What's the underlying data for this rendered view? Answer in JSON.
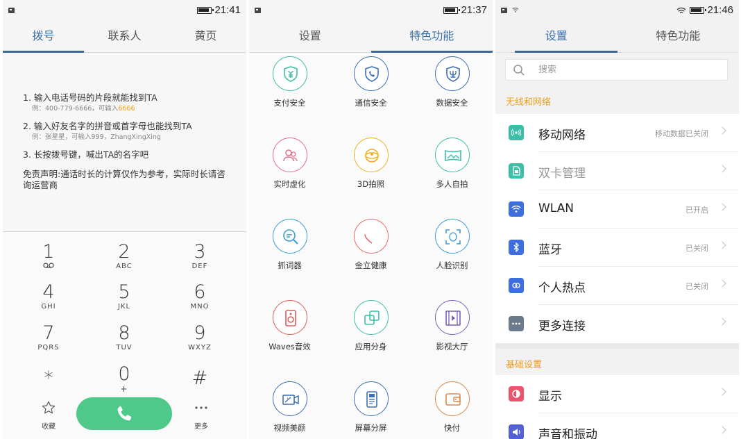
{
  "dialer": {
    "status": {
      "time": "21:41"
    },
    "tabs": [
      "拨号",
      "联系人",
      "黄页"
    ],
    "hints": [
      {
        "title": "1. 输入电话号码的片段就能找到TA",
        "example_prefix": "例：400-779-6666，可输入",
        "example_highlight": "6666"
      },
      {
        "title": "2. 输入好友名字的拼音或首字母也能找到TA",
        "example_prefix": "例：张星星，可输入999，ZhangXingXing",
        "example_highlight": ""
      },
      {
        "title": "3. 长按拨号键，喊出TA的名字吧",
        "example_prefix": "",
        "example_highlight": ""
      }
    ],
    "disclaimer": "免责声明:通话时长的计算仅作为参考，实际时长请咨询运营商",
    "keys": [
      {
        "digit": "1",
        "letters": ""
      },
      {
        "digit": "2",
        "letters": "ABC"
      },
      {
        "digit": "3",
        "letters": "DEF"
      },
      {
        "digit": "4",
        "letters": "GHI"
      },
      {
        "digit": "5",
        "letters": "JKL"
      },
      {
        "digit": "6",
        "letters": "MNO"
      },
      {
        "digit": "7",
        "letters": "PQRS"
      },
      {
        "digit": "8",
        "letters": "TUV"
      },
      {
        "digit": "9",
        "letters": "WXYZ"
      },
      {
        "digit": "*",
        "letters": ""
      },
      {
        "digit": "0",
        "letters": "+"
      },
      {
        "digit": "#",
        "letters": ""
      }
    ],
    "favorites_label": "收藏",
    "more_label": "更多",
    "call_color": "#4ec98a"
  },
  "features": {
    "status": {
      "time": "21:37"
    },
    "tabs": [
      "设置",
      "特色功能"
    ],
    "items": [
      {
        "label": "支付安全",
        "icon": "shield-yen-icon",
        "color": "#3bbfa8"
      },
      {
        "label": "通信安全",
        "icon": "shield-phone-icon",
        "color": "#3d6fb4"
      },
      {
        "label": "数据安全",
        "icon": "shield-data-icon",
        "color": "#3d6fb4"
      },
      {
        "label": "实时虚化",
        "icon": "people-blur-icon",
        "color": "#e46b86"
      },
      {
        "label": "3D拍照",
        "icon": "3d-photo-icon",
        "color": "#f0b020"
      },
      {
        "label": "多人自拍",
        "icon": "panorama-icon",
        "color": "#3bbfa8"
      },
      {
        "label": "抓词器",
        "icon": "magnifier-icon",
        "color": "#3a9bd6"
      },
      {
        "label": "金立健康",
        "icon": "heart-icon",
        "color": "#e46b6b"
      },
      {
        "label": "人脸识别",
        "icon": "face-scan-icon",
        "color": "#3a9bd6"
      },
      {
        "label": "Waves音效",
        "icon": "speaker-icon",
        "color": "#e05a5a"
      },
      {
        "label": "应用分身",
        "icon": "app-clone-icon",
        "color": "#3bbfa8"
      },
      {
        "label": "影视大厅",
        "icon": "film-icon",
        "color": "#7a5fb5"
      },
      {
        "label": "视频美颜",
        "icon": "video-beauty-icon",
        "color": "#3d6fb4"
      },
      {
        "label": "屏幕分屏",
        "icon": "split-screen-icon",
        "color": "#3d6fb4"
      },
      {
        "label": "快付",
        "icon": "wallet-icon",
        "color": "#d98a4a"
      }
    ]
  },
  "settings": {
    "status": {
      "time": "21:46"
    },
    "tabs": [
      "设置",
      "特色功能"
    ],
    "search_placeholder": "搜索",
    "section_network": "无线和网络",
    "section_basic": "基础设置",
    "rows": [
      {
        "label": "移动网络",
        "value": "移动数据已关闭",
        "icon": "antenna-icon",
        "color": "#3bbfa8",
        "dim": false
      },
      {
        "label": "双卡管理",
        "value": "",
        "icon": "sim-icon",
        "color": "#3bbfa8",
        "dim": true
      },
      {
        "label": "WLAN",
        "value": "已开启",
        "icon": "wifi-icon",
        "color": "#3d6fe0",
        "dim": false
      },
      {
        "label": "蓝牙",
        "value": "已关闭",
        "icon": "bluetooth-icon",
        "color": "#3d6fe0",
        "dim": false
      },
      {
        "label": "个人热点",
        "value": "已关闭",
        "icon": "hotspot-icon",
        "color": "#3d6fe0",
        "dim": false
      },
      {
        "label": "更多连接",
        "value": "",
        "icon": "more-dots-icon",
        "color": "#6b7a8c",
        "dim": false
      },
      {
        "label": "显示",
        "value": "",
        "icon": "display-icon",
        "color": "#e8556c",
        "dim": false
      },
      {
        "label": "声音和振动",
        "value": "",
        "icon": "sound-icon",
        "color": "#5560d6",
        "dim": false
      }
    ]
  }
}
